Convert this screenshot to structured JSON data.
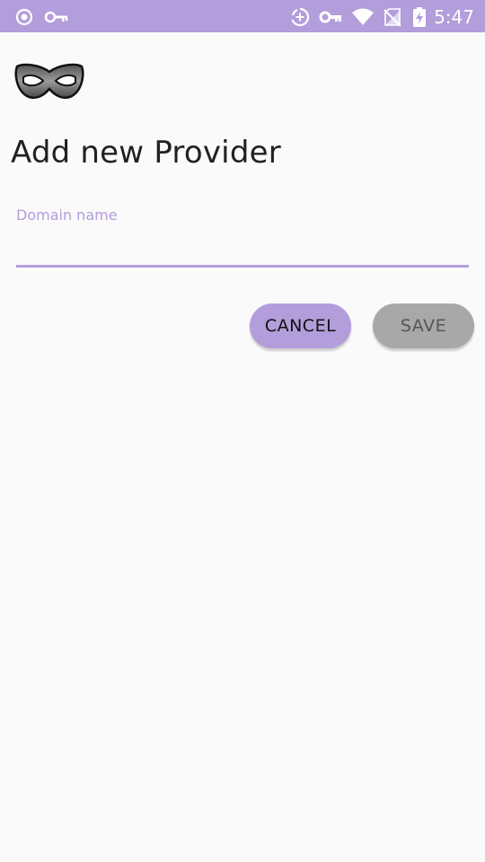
{
  "status_bar": {
    "time": "5:47",
    "icons": [
      "record-icon",
      "key-icon",
      "data-saver-icon",
      "vpn-key-icon",
      "wifi-icon",
      "no-sim-icon",
      "battery-charging-icon"
    ]
  },
  "app": {
    "logo": "mask-icon",
    "title": "Add new Provider"
  },
  "form": {
    "domain_label": "Domain name",
    "domain_value": ""
  },
  "actions": {
    "cancel_label": "CANCEL",
    "save_label": "SAVE"
  },
  "colors": {
    "accent": "#b39ddb",
    "background": "#fafafa",
    "disabled_button": "#a8a8a8"
  }
}
